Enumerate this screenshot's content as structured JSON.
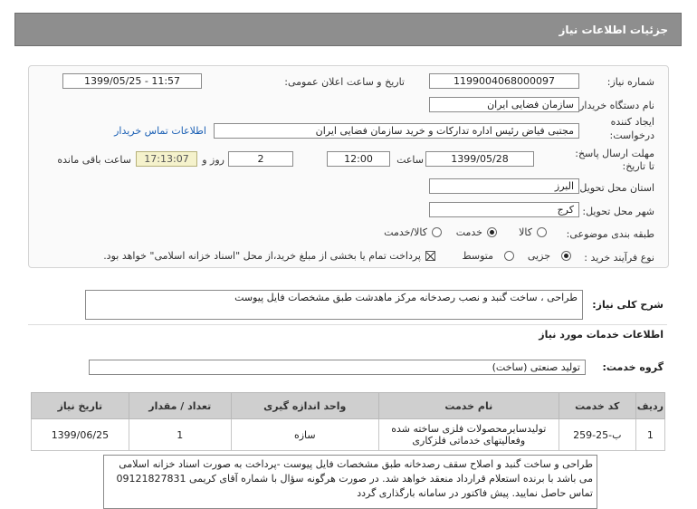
{
  "header": {
    "title": "جزئیات اطلاعات نیاز"
  },
  "form": {
    "need_number_label": "شماره نیاز:",
    "need_number": "1199004068000097",
    "announce_label": "تاریخ و ساعت اعلان عمومی:",
    "announce_value": "1399/05/25 - 11:57",
    "buyer_org_label": "نام دستگاه خریدار:",
    "buyer_org": "سازمان فضایی ایران",
    "creator_label_1": "ایجاد کننده",
    "creator_label_2": "درخواست:",
    "creator": "مجتبی  فیاض رئیس اداره تدارکات و خرید سازمان فضایی ایران",
    "contact_link": "اطلاعات تماس خریدار",
    "deadline_label_1": "مهلت ارسال پاسخ:",
    "deadline_label_2": "تا تاریخ:",
    "deadline_date": "1399/05/28",
    "time_label": "ساعت",
    "deadline_time": "12:00",
    "days_value": "2",
    "days_label": "روز و",
    "remaining_time": "17:13:07",
    "remaining_label": "ساعت باقی مانده",
    "province_label": "استان محل تحویل:",
    "province": "البرز",
    "city_label": "شهر محل تحویل:",
    "city": "کرج",
    "category_label": "طبقه بندی موضوعی:",
    "category_options": [
      "کالا",
      "خدمت",
      "کالا/خدمت"
    ],
    "category_selected": "خدمت",
    "process_label": "نوع فرآیند خرید :",
    "process_options": [
      "جزیی",
      "متوسط"
    ],
    "process_selected": "جزیی",
    "payment_note": "پرداخت تمام یا بخشی از مبلغ خرید،از محل \"اسناد خزانه اسلامی\" خواهد بود."
  },
  "summary": {
    "label": "شرح کلی نیاز:",
    "value": "طراحی ، ساخت گنبد و نصب رصدخانه مرکز ماهدشت طبق مشخصات فایل پیوست"
  },
  "services_section": {
    "title": "اطلاعات خدمات مورد نیاز"
  },
  "service_group": {
    "label": "گروه خدمت:",
    "value": "تولید صنعتی (ساخت)"
  },
  "table": {
    "headers": [
      "ردیف",
      "کد خدمت",
      "نام خدمت",
      "واحد اندازه گیری",
      "تعداد / مقدار",
      "تاریخ نیاز"
    ],
    "rows": [
      [
        "1",
        "ب-25-259",
        "تولیدسایرمحصولات فلزی ساخته شده وفعالیتهای خدماتی فلزکاری",
        "سازه",
        "1",
        "1399/06/25"
      ]
    ]
  },
  "description": "طراحی و ساخت گنبد و اصلاح سقف رصدخانه طبق مشخصات فایل پیوست -پرداخت به صورت اسناد خزانه اسلامی می باشد با برنده استعلام قرارداد منعقد خواهد شد. در صورت هرگونه سؤال با شماره آقای کریمی 09121827831 تماس حاصل نمایید. پیش فاکتور در سامانه بارگذاری گردد"
}
